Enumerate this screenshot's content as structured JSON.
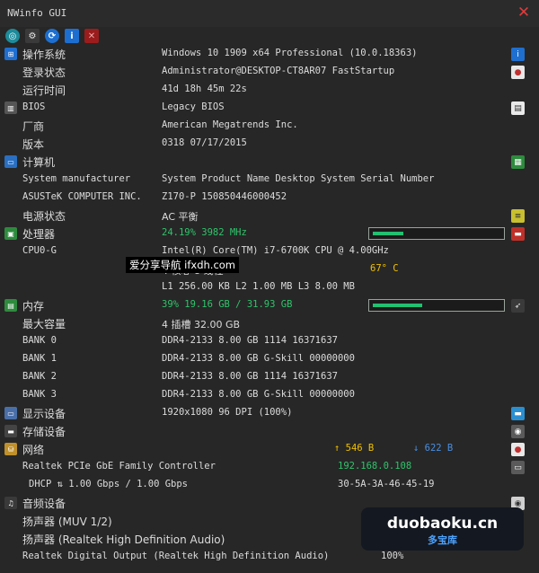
{
  "window": {
    "title": "NWinfo GUI"
  },
  "toolbar": {
    "info_glyph": "i"
  },
  "os": {
    "label": "操作系统",
    "value": "Windows 10 1909 x64 Professional (10.0.18363)",
    "login_label": "登录状态",
    "login_value": "Administrator@DESKTOP-CT8AR07 FastStartup",
    "uptime_label": "运行时间",
    "uptime_value": "41d 18h 45m 22s"
  },
  "bios": {
    "label": "BIOS",
    "value": "Legacy BIOS",
    "vendor_label": "厂商",
    "vendor_value": "American Megatrends Inc.",
    "version_label": "版本",
    "version_value": "0318 07/17/2015"
  },
  "computer": {
    "label": "计算机",
    "manufacturer_label": "System manufacturer",
    "manufacturer_value": "System Product Name Desktop System Serial Number",
    "board_label": "ASUSTeK COMPUTER INC.",
    "board_value": "Z170-P 150850446000452",
    "power_label": "电源状态",
    "power_value": "AC  平衡"
  },
  "cpu": {
    "label": "处理器",
    "usage": "24.19% 3982 MHz",
    "usage_fraction": 0.24,
    "id_label": "CPU0-G",
    "model": "Intel(R) Core(TM) i7-6700K CPU @ 4.00GHz",
    "cores_value": "4 核心 8 线程",
    "temperature": "67° C",
    "cache": "L1 256.00 KB L2 1.00 MB L3 8.00 MB",
    "overlay_text": "爱分享导航 ifxdh.com"
  },
  "memory": {
    "label": "内存",
    "usage": "39% 19.16 GB / 31.93 GB",
    "usage_fraction": 0.39,
    "capacity_label": "最大容量",
    "capacity_value": "4 插槽 32.00 GB",
    "banks": [
      {
        "label": "BANK 0",
        "value": "DDR4-2133 8.00 GB 1114 16371637"
      },
      {
        "label": "BANK 1",
        "value": "DDR4-2133 8.00 GB G-Skill 00000000"
      },
      {
        "label": "BANK 2",
        "value": "DDR4-2133 8.00 GB 1114 16371637"
      },
      {
        "label": "BANK 3",
        "value": "DDR4-2133 8.00 GB G-Skill 00000000"
      }
    ]
  },
  "display": {
    "label": "显示设备",
    "value": "1920x1080 96 DPI (100%)"
  },
  "storage": {
    "label": "存储设备"
  },
  "network": {
    "label": "网络",
    "up": "↑ 546 B",
    "down": "↓ 622 B",
    "adapter_label": "Realtek PCIe GbE Family Controller",
    "ip": "192.168.0.108",
    "dhcp_label": "DHCP ⇅ 1.00 Gbps / 1.00 Gbps",
    "mac": "30-5A-3A-46-45-19"
  },
  "audio": {
    "label": "音频设备",
    "speaker1": "扬声器 (MUV 1/2)",
    "speaker2": "扬声器 (Realtek High Definition Audio)",
    "digital": "Realtek Digital Output (Realtek High Definition Audio)",
    "digital_volume": "100%"
  },
  "watermark": {
    "site": "duobaoku.cn",
    "name": "多宝库"
  },
  "colors": {
    "background": "#272727",
    "accent_green": "#2fc46a",
    "temp_yellow": "#f0c000",
    "net_blue": "#4a8fe0"
  }
}
